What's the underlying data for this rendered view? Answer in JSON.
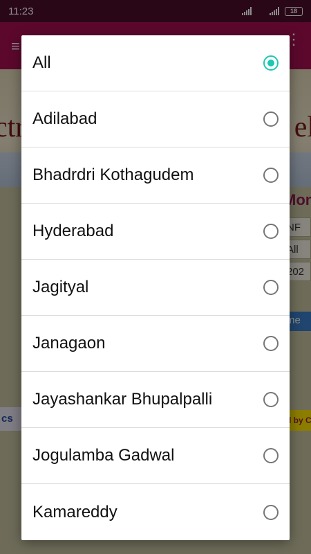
{
  "status_bar": {
    "time": "11:23",
    "battery": "18",
    "icons": [
      "signal-icon",
      "signal-icon",
      "battery-icon"
    ]
  },
  "background_app": {
    "banner_left_text": "ctr",
    "banner_right_text": "el",
    "heading_partial": "Mon",
    "field_1": "NF",
    "field_2": "All",
    "field_3": "202",
    "button_partial": "me",
    "footer_left_partial": "cs",
    "footer_right_partial": "d by C"
  },
  "dialog": {
    "selected_index": 0,
    "accent_color": "#1ec6b6",
    "options": [
      {
        "label": "All",
        "selected": true
      },
      {
        "label": "Adilabad",
        "selected": false
      },
      {
        "label": "Bhadrdri Kothagudem",
        "selected": false
      },
      {
        "label": "Hyderabad",
        "selected": false
      },
      {
        "label": "Jagityal",
        "selected": false
      },
      {
        "label": "Janagaon",
        "selected": false
      },
      {
        "label": "Jayashankar Bhupalpalli",
        "selected": false
      },
      {
        "label": "Jogulamba Gadwal",
        "selected": false
      },
      {
        "label": "Kamareddy",
        "selected": false
      }
    ]
  }
}
